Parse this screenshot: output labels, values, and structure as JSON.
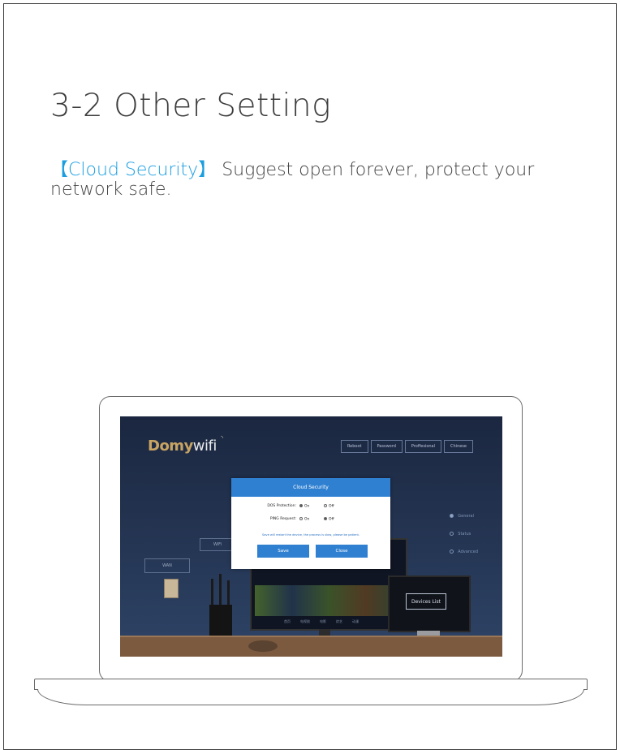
{
  "title": "3-2 Other Setting",
  "description": {
    "bracket_open": "【",
    "highlight": "Cloud Security",
    "bracket_close": "】",
    "text": "Suggest open forever, protect your network safe."
  },
  "screen": {
    "brand": {
      "part1": "Domy",
      "part2": "wifi"
    },
    "nav": [
      "Reboot",
      "Password",
      "Proffesional",
      "Chinese"
    ],
    "side_menu": [
      {
        "label": "General",
        "active": true
      },
      {
        "label": "Status",
        "active": false
      },
      {
        "label": "Advanced",
        "active": false
      }
    ],
    "wan_label": "WAN",
    "wifi_label": "WiFi",
    "tv_labels": [
      "首页",
      "电视剧",
      "电影",
      "综艺",
      "动漫"
    ],
    "devices_button": "Devices List",
    "dialog": {
      "title": "Cloud Security",
      "rows": [
        {
          "label": "DOS Protection:",
          "on": "On",
          "off": "Off",
          "selected": "on"
        },
        {
          "label": "PING Request:",
          "on": "On",
          "off": "Off",
          "selected": "off"
        }
      ],
      "note": "Save will restart the device, the process is slow, please be patient.",
      "save_label": "Save",
      "close_label": "Close"
    }
  }
}
